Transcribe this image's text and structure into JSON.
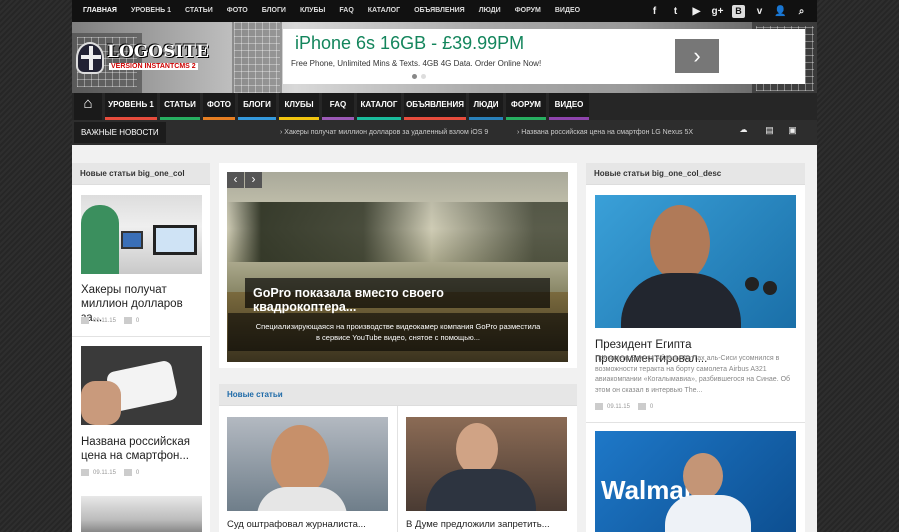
{
  "topnav": [
    "Главная",
    "Уровень 1",
    "Статьи",
    "Фото",
    "Блоги",
    "Клубы",
    "FAQ",
    "Каталог",
    "Объявления",
    "Люди",
    "Форум",
    "Видео"
  ],
  "social_icons": [
    "facebook-icon",
    "twitter-icon",
    "youtube-icon",
    "google-plus-icon",
    "vk-icon",
    "vimeo-icon",
    "user-icon",
    "search-icon"
  ],
  "social_glyphs": [
    "f",
    "t",
    "▶",
    "g+",
    "В",
    "v",
    "👤",
    "⌕"
  ],
  "logo": {
    "title": "LOGOSITE",
    "subtitle": "VERSION INSTANTCMS 2"
  },
  "ad": {
    "headline": "iPhone 6s 16GB - £39.99PM",
    "text": "Free Phone, Unlimited Mins & Texts. 4GB 4G Data. Order Online Now!",
    "button": "›"
  },
  "mainnav": [
    "Уровень 1",
    "Статьи",
    "Фото",
    "Блоги",
    "Клубы",
    "FAQ",
    "Каталог",
    "Объявления",
    "Люди",
    "Форум",
    "Видео"
  ],
  "home_icon": "⌂",
  "news": {
    "label": "ВАЖНЫЕ НОВОСТИ",
    "items": [
      "› Хакеры получат миллион долларов за удаленный взлом iOS 9",
      "› Названа российская цена на смартфон LG Nexus 5X"
    ]
  },
  "left": {
    "title": "Новые статьи big_one_col",
    "articles": [
      {
        "title": "Хакеры получат миллион долларов за...",
        "date": "09.11.15",
        "comments": "0"
      },
      {
        "title": "Названа российская цена на смартфон...",
        "date": "09.11.15",
        "comments": "0"
      }
    ]
  },
  "slider": {
    "prev": "‹",
    "next": "›",
    "title": "GoPro показала вместо своего квадрокоптера...",
    "text": "Специализирующаяся на производстве видеокамер компания GoPro разместила в сервисе YouTube видео, снятое с помощью..."
  },
  "center_list": {
    "title": "Новые статьи",
    "articles": [
      {
        "title": "Суд оштрафовал журналиста..."
      },
      {
        "title": "В Думе предложили запретить..."
      }
    ]
  },
  "right": {
    "title": "Новые статьи big_one_col_desc",
    "article": {
      "title": "Президент Египта прокомментировал...",
      "text": "Президент Египта Абдель-Фаттах аль-Сиси усомнился в возможности теракта на борту самолета Airbus A321 авиакомпании «Когалымавиа», разбившегося на Синае. Об этом он сказал в интервью The...",
      "date": "09.11.15",
      "comments": "0"
    }
  },
  "colors": {
    "nav_bars": [
      "#e74c3c",
      "#27ae60",
      "#3498db",
      "#f39c12",
      "#9b59b6",
      "#1abc9c",
      "#e67e22",
      "#2980b9",
      "#c0392b",
      "#16a085",
      "#8e44ad"
    ]
  }
}
